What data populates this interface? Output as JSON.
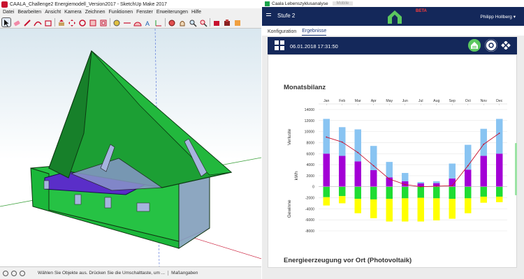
{
  "sketchup": {
    "title": "CAALA_Challenge2 Energiemodell_Version2017 - SketchUp Make 2017",
    "menu": [
      "Datei",
      "Bearbeiten",
      "Ansicht",
      "Kamera",
      "Zeichnen",
      "Funktionen",
      "Fenster",
      "Erweiterungen",
      "Hilfe"
    ],
    "toolbar_icons": [
      "select-icon",
      "eraser-icon",
      "pencil-icon",
      "arc-icon",
      "shape-icon",
      "push-pull-icon",
      "move-icon",
      "rotate-icon",
      "scale-icon",
      "offset-icon",
      "tape-measure-icon",
      "dimension-icon",
      "protractor-icon",
      "text-icon",
      "axes-icon",
      "orbit-icon",
      "pan-icon",
      "zoom-icon",
      "zoom-extents-icon",
      "warehouse-icon",
      "extension-icon",
      "layout-icon"
    ],
    "status_text": "Wählen Sie Objekte aus. Drücken Sie die Umschalttaste, um ...",
    "measure_label": "Maßangaben"
  },
  "caala": {
    "window_title": "Caala Lebenszyklusanalyse",
    "ghost_tab": "Mobile",
    "stage": "Stufe 2",
    "beta": "BETA",
    "user": "Philipp Hollberg ▾",
    "tabs": [
      "Konfiguration",
      "Ergebnisse"
    ],
    "active_tab": 1,
    "datetime": "06.01.2018 17:31:50",
    "section_title": "Monatsbilanz",
    "section_title_2": "Energieerzeugung vor Ort (Photovoltaik)",
    "accent": "#14285a"
  },
  "chart_data": {
    "type": "bar",
    "stacked": true,
    "categories": [
      "Jan",
      "Feb",
      "Mar",
      "Apr",
      "May",
      "Jun",
      "Jul",
      "Aug",
      "Sep",
      "Oct",
      "Nov",
      "Dec"
    ],
    "ylabel": "kWh",
    "group_label_top": "Verluste",
    "group_label_bottom": "Gewinne",
    "ylim": [
      -8000,
      14000
    ],
    "yticks": [
      14000,
      12000,
      10000,
      8000,
      6000,
      4000,
      2000,
      0,
      -2000,
      -4000,
      -6000,
      -8000
    ],
    "grid": true,
    "positive_series": [
      {
        "color": "#a300d6",
        "values": [
          6000,
          5600,
          4600,
          3000,
          1700,
          1000,
          600,
          650,
          1500,
          3100,
          5600,
          6000
        ]
      },
      {
        "color": "#89c4f2",
        "values": [
          6300,
          5200,
          5800,
          4400,
          2800,
          1500,
          250,
          350,
          2700,
          4500,
          4900,
          6300
        ]
      }
    ],
    "negative_series": [
      {
        "color": "#1fdc32",
        "values": [
          -1900,
          -1700,
          -2200,
          -2300,
          -2200,
          -2100,
          -2000,
          -2100,
          -2200,
          -2100,
          -1800,
          -1800
        ]
      },
      {
        "color": "#ffff00",
        "values": [
          -1500,
          -1300,
          -2600,
          -3400,
          -4100,
          -4200,
          -4300,
          -4000,
          -3600,
          -2700,
          -1100,
          -1000
        ]
      }
    ],
    "line_series": {
      "color": "#c8102e",
      "values": [
        9000,
        8100,
        6200,
        3800,
        1400,
        400,
        0,
        100,
        200,
        3800,
        7700,
        9700
      ]
    }
  }
}
